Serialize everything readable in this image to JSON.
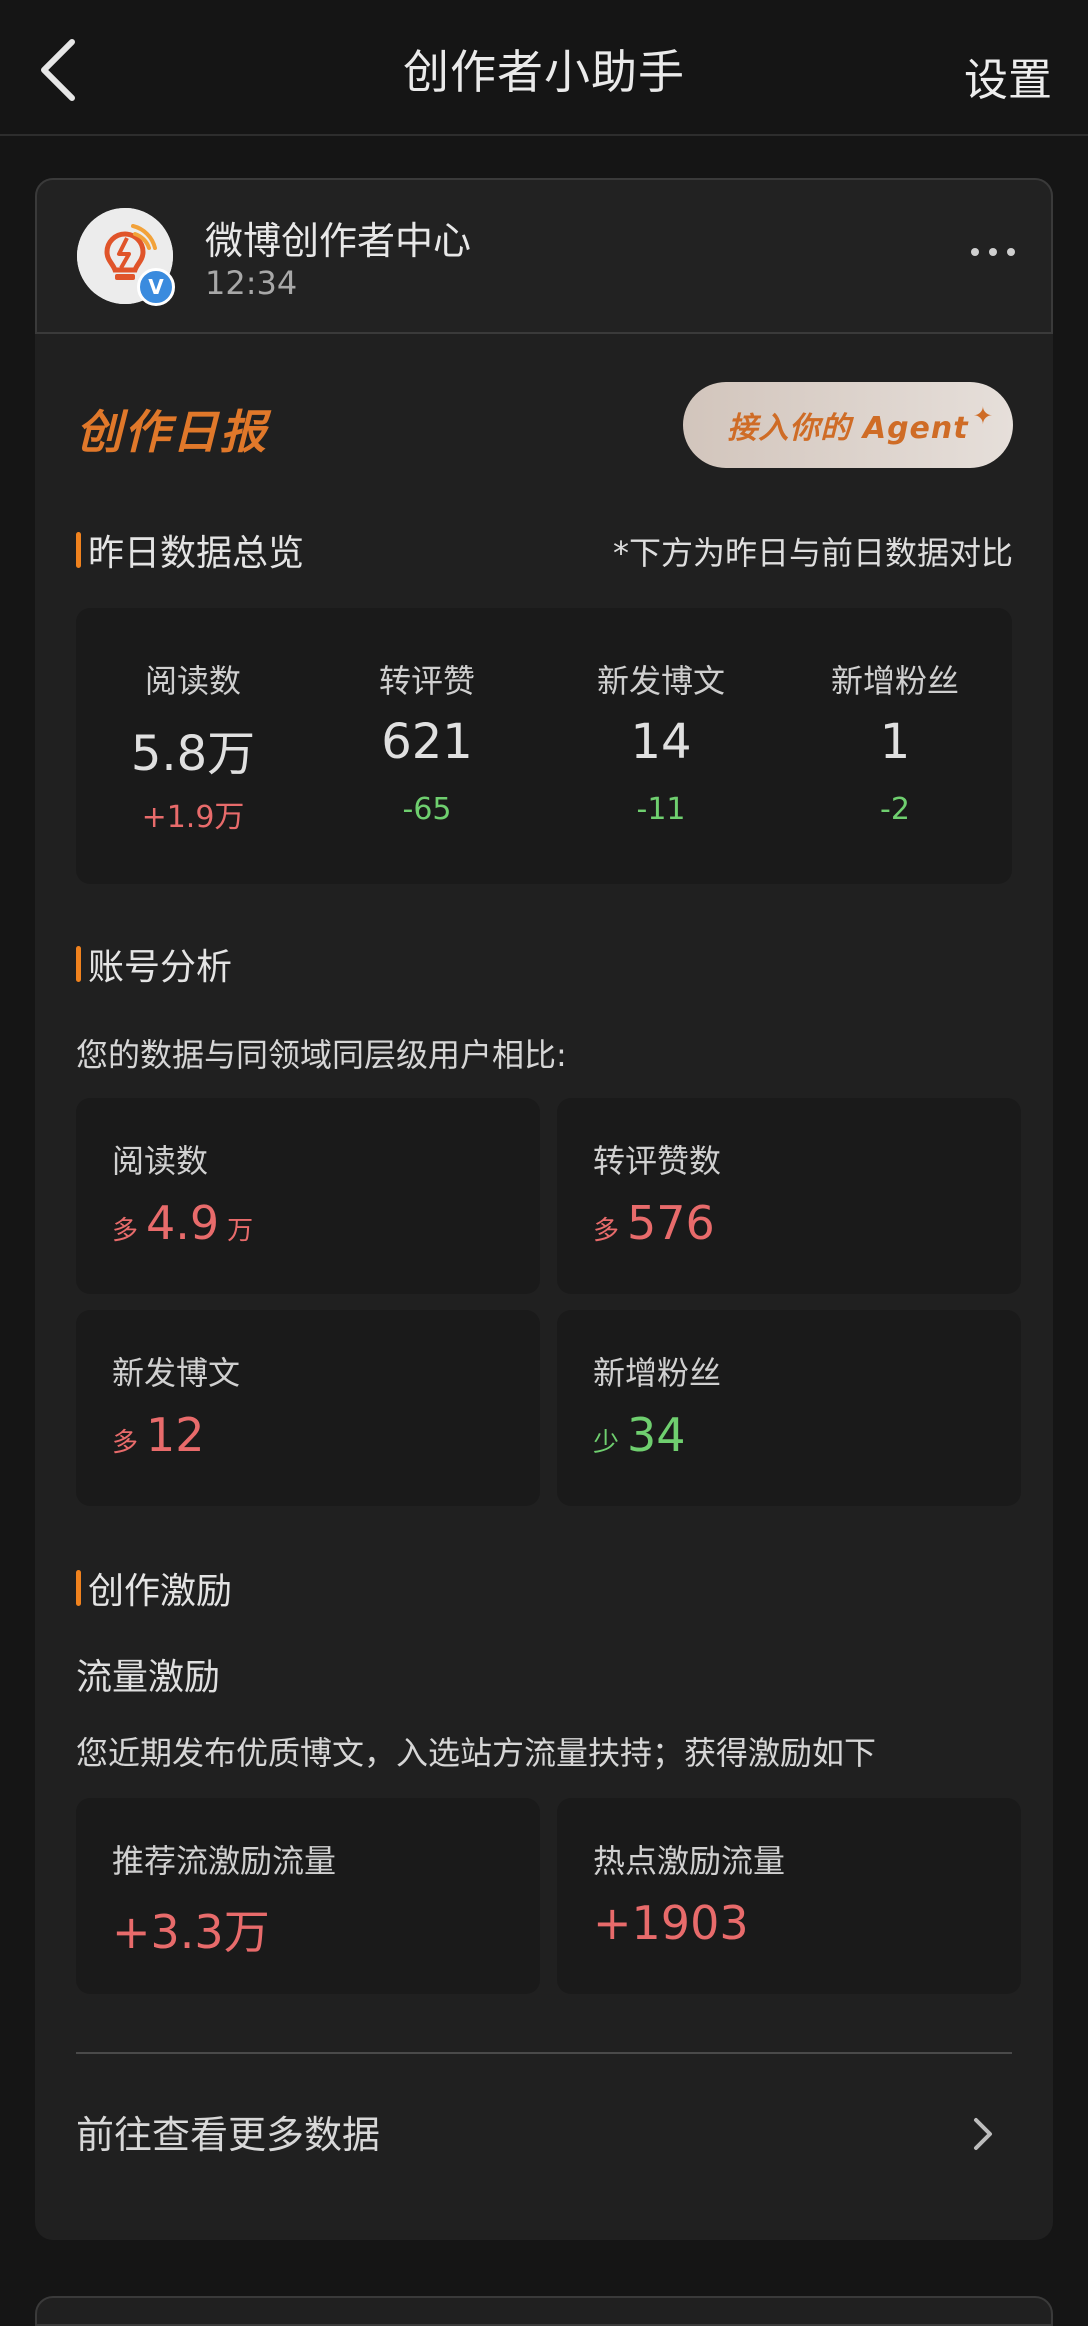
{
  "topbar": {
    "title": "创作者小助手",
    "settings_label": "设置"
  },
  "account": {
    "name": "微博创作者中心",
    "time": "12:34",
    "verified_badge": "V"
  },
  "report": {
    "title": "创作日报",
    "agent_button": "接入你的 Agent",
    "sparkle": "✦"
  },
  "overview": {
    "title": "昨日数据总览",
    "note": "*下方为昨日与前日数据对比",
    "metrics": [
      {
        "label": "阅读数",
        "value": "5.8万",
        "delta": "+1.9万",
        "trend": "up"
      },
      {
        "label": "转评赞",
        "value": "621",
        "delta": "-65",
        "trend": "down"
      },
      {
        "label": "新发博文",
        "value": "14",
        "delta": "-11",
        "trend": "down"
      },
      {
        "label": "新增粉丝",
        "value": "1",
        "delta": "-2",
        "trend": "down"
      }
    ]
  },
  "analysis": {
    "title": "账号分析",
    "subtitle": "您的数据与同领域同层级用户相比:",
    "items": [
      {
        "label": "阅读数",
        "prefix": "多",
        "value": "4.9",
        "unit": "万",
        "trend": "up"
      },
      {
        "label": "转评赞数",
        "prefix": "多",
        "value": "576",
        "unit": "",
        "trend": "up"
      },
      {
        "label": "新发博文",
        "prefix": "多",
        "value": "12",
        "unit": "",
        "trend": "up"
      },
      {
        "label": "新增粉丝",
        "prefix": "少",
        "value": "34",
        "unit": "",
        "trend": "down"
      }
    ]
  },
  "incentive": {
    "title": "创作激励",
    "traffic_title": "流量激励",
    "traffic_desc": "您近期发布优质博文，入选站方流量扶持；获得激励如下",
    "rewards": [
      {
        "label": "推荐流激励流量",
        "value": "+3.3万"
      },
      {
        "label": "热点激励流量",
        "value": "+1903"
      }
    ]
  },
  "more_data": {
    "label": "前往查看更多数据"
  },
  "colors": {
    "accent": "#f0821e",
    "up": "#e86b6b",
    "down": "#6fcf6f",
    "background": "#151515",
    "card": "#202020"
  }
}
